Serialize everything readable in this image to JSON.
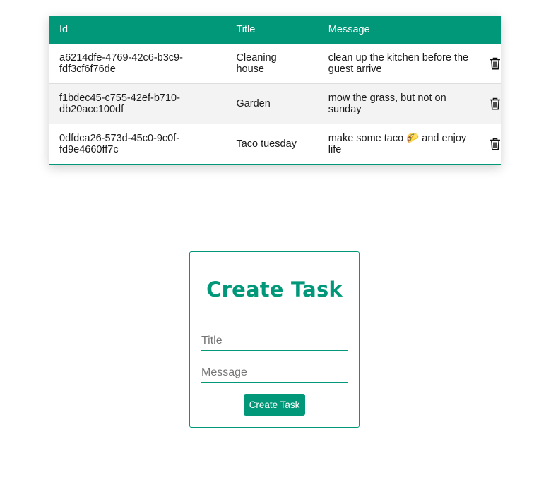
{
  "table": {
    "headers": {
      "id": "Id",
      "title": "Title",
      "message": "Message"
    },
    "rows": [
      {
        "id_line1": "a6214dfe-4769-42c6-b3c9-",
        "id_line2": "fdf3cf6f76de",
        "title_line1": "Cleaning",
        "title_line2": "house",
        "message_line1": "clean up the kitchen before the",
        "message_line2": "guest arrive",
        "delete_icon": "trash-icon"
      },
      {
        "id_line1": "f1bdec45-c755-42ef-b710-",
        "id_line2": "db20acc100df",
        "title_line1": "Garden",
        "title_line2": "",
        "message_line1": "mow the grass, but not on",
        "message_line2": "sunday",
        "delete_icon": "trash-icon"
      },
      {
        "id_line1": "0dfdca26-573d-45c0-9c0f-",
        "id_line2": "fd9e4660ff7c",
        "title_line1": "Taco tuesday",
        "title_line2": "",
        "message_line1": "make some taco 🌮 and enjoy",
        "message_line2": "life",
        "delete_icon": "trash-icon"
      }
    ]
  },
  "form": {
    "heading": "Create Task",
    "title_placeholder": "Title",
    "title_value": "",
    "message_placeholder": "Message",
    "message_value": "",
    "submit_label": "Create Task"
  },
  "colors": {
    "accent": "#009879",
    "row_alt": "#f3f3f3",
    "header_text": "#ffffff"
  }
}
